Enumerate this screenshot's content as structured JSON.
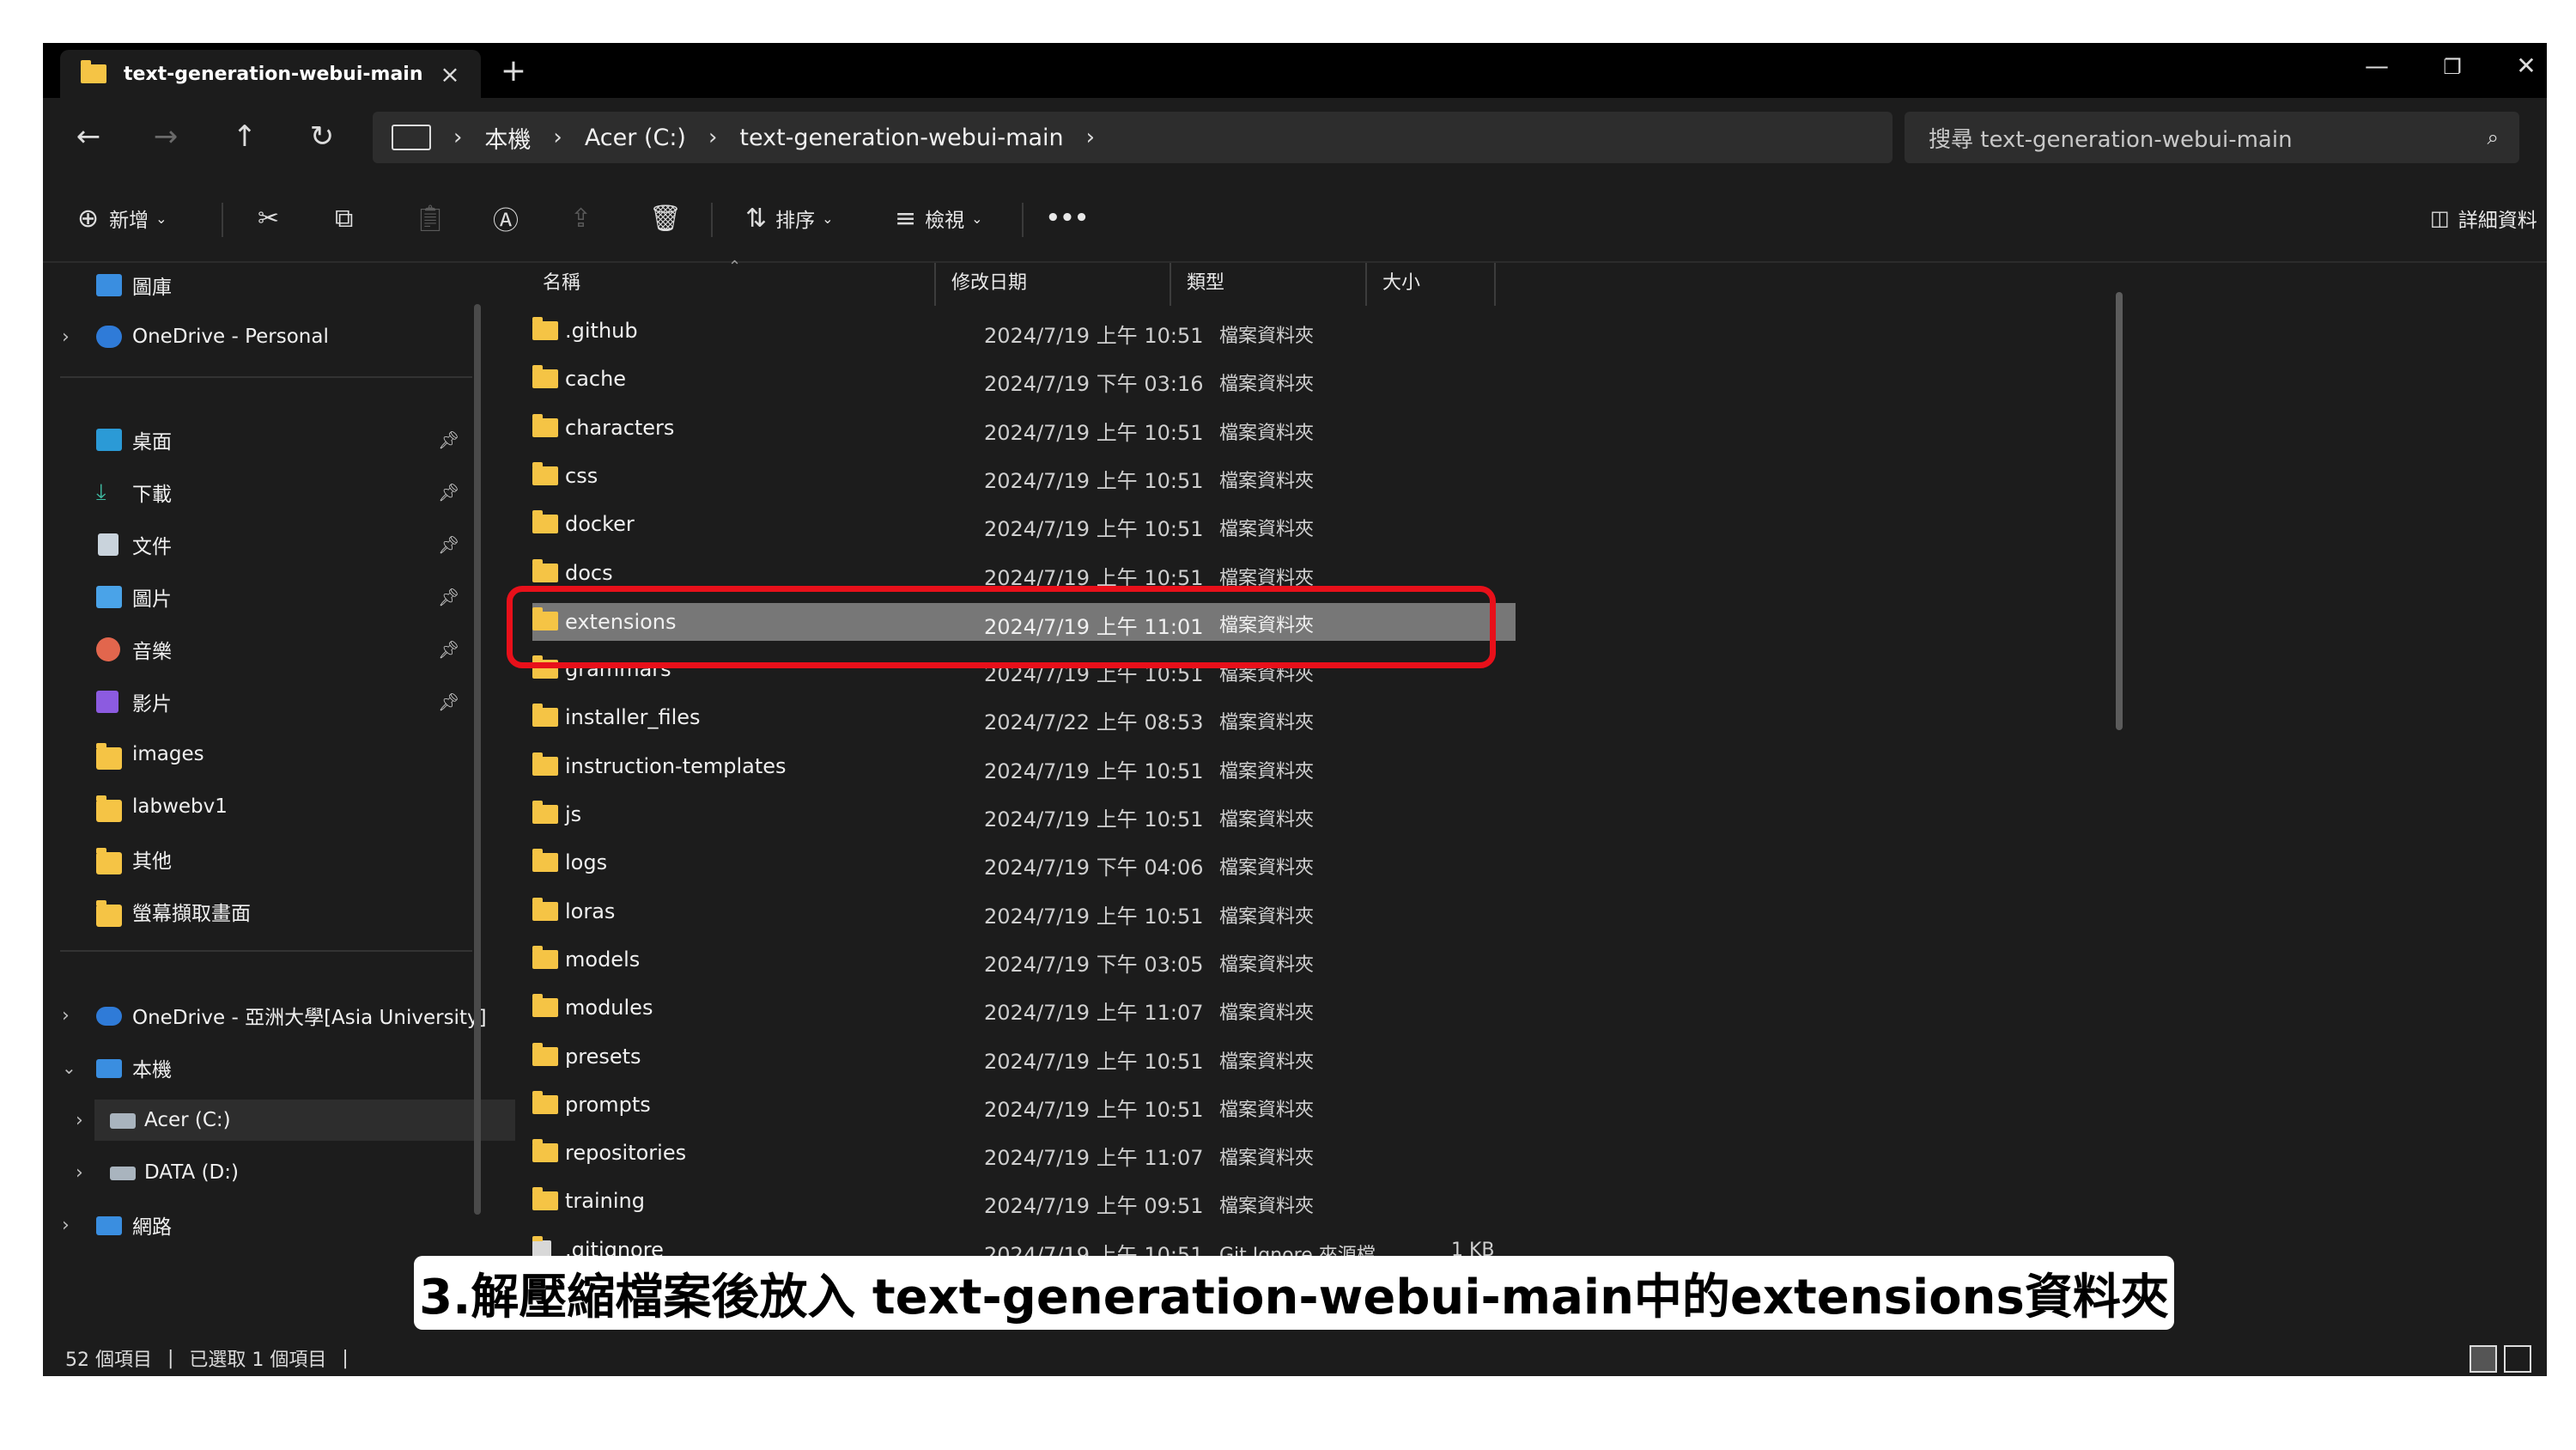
{
  "window": {
    "tab_title": "text-generation-webui-main",
    "new_tab_label": "+",
    "minimize_label": "—",
    "maximize_label": "❐",
    "close_label": "✕"
  },
  "nav": {
    "back": "←",
    "forward": "→",
    "up": "↑",
    "refresh": "↻",
    "breadcrumb": [
      "本機",
      "Acer (C:)",
      "text-generation-webui-main"
    ],
    "search_placeholder": "搜尋 text-generation-webui-main"
  },
  "toolbar": {
    "new_label": "新增",
    "sort_label": "排序",
    "view_label": "檢視",
    "more_label": "•••",
    "details_label": "詳細資料"
  },
  "sidebar": {
    "gallery": "圖庫",
    "onedrive_personal": "OneDrive - Personal",
    "quick_access": [
      "桌面",
      "下載",
      "文件",
      "圖片",
      "音樂",
      "影片",
      "images",
      "labwebv1",
      "其他",
      "螢幕擷取畫面"
    ],
    "onedrive_asia": "OneDrive - 亞洲大學[Asia University]",
    "this_pc": "本機",
    "drive_c": "Acer (C:)",
    "drive_d": "DATA (D:)",
    "network": "網路"
  },
  "columns": {
    "name": "名稱",
    "modified": "修改日期",
    "type": "類型",
    "size": "大小"
  },
  "files": [
    {
      "name": ".github",
      "date": "2024/7/19 上午 10:51",
      "type": "檔案資料夾",
      "size": ""
    },
    {
      "name": "cache",
      "date": "2024/7/19 下午 03:16",
      "type": "檔案資料夾",
      "size": ""
    },
    {
      "name": "characters",
      "date": "2024/7/19 上午 10:51",
      "type": "檔案資料夾",
      "size": ""
    },
    {
      "name": "css",
      "date": "2024/7/19 上午 10:51",
      "type": "檔案資料夾",
      "size": ""
    },
    {
      "name": "docker",
      "date": "2024/7/19 上午 10:51",
      "type": "檔案資料夾",
      "size": ""
    },
    {
      "name": "docs",
      "date": "2024/7/19 上午 10:51",
      "type": "檔案資料夾",
      "size": ""
    },
    {
      "name": "extensions",
      "date": "2024/7/19 上午 11:01",
      "type": "檔案資料夾",
      "size": ""
    },
    {
      "name": "grammars",
      "date": "2024/7/19 上午 10:51",
      "type": "檔案資料夾",
      "size": ""
    },
    {
      "name": "installer_files",
      "date": "2024/7/22 上午 08:53",
      "type": "檔案資料夾",
      "size": ""
    },
    {
      "name": "instruction-templates",
      "date": "2024/7/19 上午 10:51",
      "type": "檔案資料夾",
      "size": ""
    },
    {
      "name": "js",
      "date": "2024/7/19 上午 10:51",
      "type": "檔案資料夾",
      "size": ""
    },
    {
      "name": "logs",
      "date": "2024/7/19 下午 04:06",
      "type": "檔案資料夾",
      "size": ""
    },
    {
      "name": "loras",
      "date": "2024/7/19 上午 10:51",
      "type": "檔案資料夾",
      "size": ""
    },
    {
      "name": "models",
      "date": "2024/7/19 下午 03:05",
      "type": "檔案資料夾",
      "size": ""
    },
    {
      "name": "modules",
      "date": "2024/7/19 上午 11:07",
      "type": "檔案資料夾",
      "size": ""
    },
    {
      "name": "presets",
      "date": "2024/7/19 上午 10:51",
      "type": "檔案資料夾",
      "size": ""
    },
    {
      "name": "prompts",
      "date": "2024/7/19 上午 10:51",
      "type": "檔案資料夾",
      "size": ""
    },
    {
      "name": "repositories",
      "date": "2024/7/19 上午 11:07",
      "type": "檔案資料夾",
      "size": ""
    },
    {
      "name": "training",
      "date": "2024/7/19 上午 09:51",
      "type": "檔案資料夾",
      "size": ""
    },
    {
      "name": ".gitignore",
      "date": "2024/7/19 上午 10:51",
      "type": "Git Ignore 來源檔",
      "size": "1 KB"
    }
  ],
  "selected_file": "extensions",
  "status": {
    "count": "52 個項目",
    "selected": "已選取 1 個項目"
  },
  "caption": "3.解壓縮檔案後放入 text-generation-webui-main中的extensions資料夾",
  "colors": {
    "highlight": "#e8101a",
    "folder": "#f5c445",
    "selection": "#777777"
  }
}
